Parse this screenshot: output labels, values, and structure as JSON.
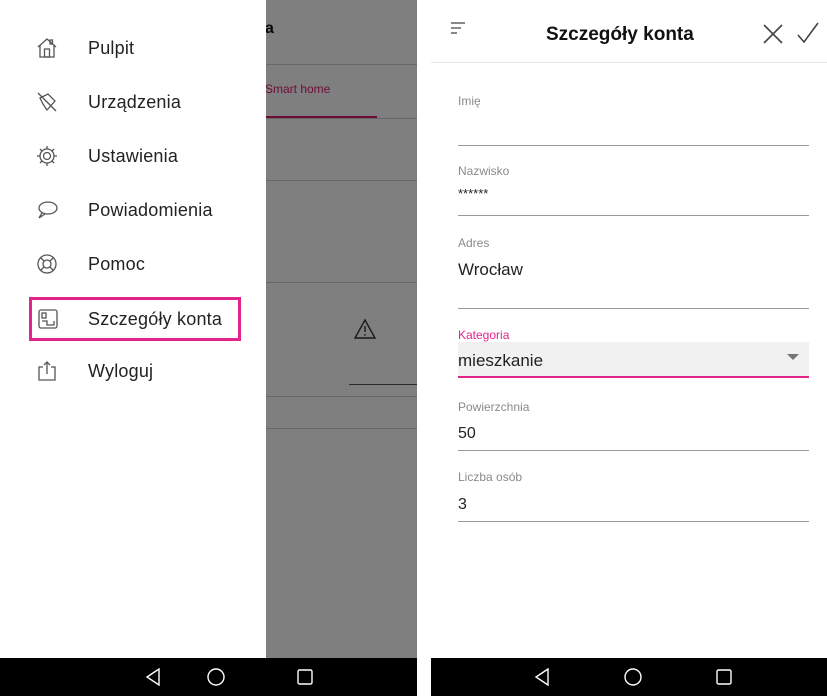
{
  "drawer": {
    "items": [
      {
        "label": "Pulpit",
        "icon": "home-icon"
      },
      {
        "label": "Urządzenia",
        "icon": "devices-icon"
      },
      {
        "label": "Ustawienia",
        "icon": "settings-gear-icon"
      },
      {
        "label": "Powiadomienia",
        "icon": "notification-chat-icon"
      },
      {
        "label": "Pomoc",
        "icon": "help-lifebuoy-icon"
      },
      {
        "label": "Szczegóły konta",
        "icon": "account-details-icon",
        "active": true
      },
      {
        "label": "Wyloguj",
        "icon": "logout-icon"
      }
    ],
    "highlight_color": "#e3248d"
  },
  "background_app": {
    "title_fragment": "a",
    "tab_fragment": "Smart home",
    "tab_color": "#d81b70"
  },
  "account": {
    "title": "Szczegóły konta",
    "accent_color": "#e3248d",
    "fields": {
      "imie": {
        "label": "Imię",
        "value": ""
      },
      "nazwisko": {
        "label": "Nazwisko",
        "value": "******"
      },
      "adres": {
        "label": "Adres",
        "value": "Wrocław"
      },
      "kategoria": {
        "label": "Kategoria",
        "value": "mieszkanie"
      },
      "powierzchnia": {
        "label": "Powierzchnia",
        "value": "50"
      },
      "liczba_osob": {
        "label": "Liczba osób",
        "value": "3"
      }
    }
  },
  "nav": {
    "buttons": [
      "back-triangle-icon",
      "home-circle-icon",
      "recents-square-icon"
    ]
  }
}
